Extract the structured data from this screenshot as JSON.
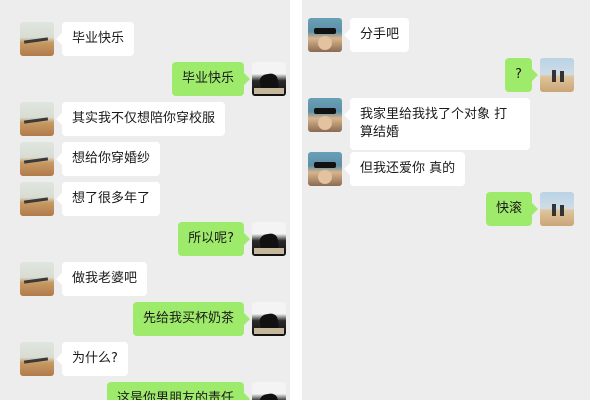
{
  "left_chat": {
    "messages": [
      {
        "side": "in",
        "text": "毕业快乐"
      },
      {
        "side": "out",
        "text": "毕业快乐"
      },
      {
        "side": "in",
        "text": "其实我不仅想陪你穿校服"
      },
      {
        "side": "in",
        "text": "想给你穿婚纱"
      },
      {
        "side": "in",
        "text": "想了很多年了"
      },
      {
        "side": "out",
        "text": "所以呢?"
      },
      {
        "side": "in",
        "text": "做我老婆吧"
      },
      {
        "side": "out",
        "text": "先给我买杯奶茶"
      },
      {
        "side": "in",
        "text": "为什么?"
      },
      {
        "side": "out",
        "text": "这是你男朋友的责任"
      }
    ]
  },
  "right_chat": {
    "messages": [
      {
        "side": "in",
        "text": "分手吧"
      },
      {
        "side": "out",
        "text": "?"
      },
      {
        "side": "in",
        "text": "我家里给我找了个对象 打算结婚"
      },
      {
        "side": "in",
        "text": "但我还爱你 真的"
      },
      {
        "side": "out",
        "text": "快滚"
      }
    ]
  },
  "colors": {
    "background": "#ededed",
    "bubble_in": "#ffffff",
    "bubble_out": "#9eea6a"
  },
  "icons": {
    "left_in_avatar": "beach-avatar-icon",
    "left_out_avatar": "dark-hair-avatar-icon",
    "right_in_avatar": "face-avatar-icon",
    "right_out_avatar": "desert-avatar-icon"
  }
}
